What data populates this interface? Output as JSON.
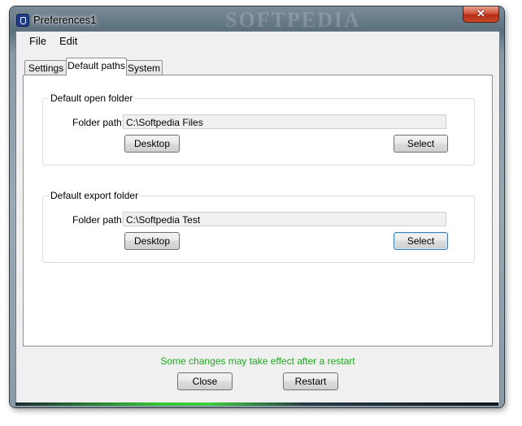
{
  "window": {
    "title": "Preferences1",
    "watermark": "SOFTPEDIA",
    "close_glyph": "✕"
  },
  "menu": [
    {
      "label": "File"
    },
    {
      "label": "Edit"
    }
  ],
  "tabs": [
    {
      "label": "Settings",
      "active": false
    },
    {
      "label": "Default paths",
      "active": true
    },
    {
      "label": "System",
      "active": false
    }
  ],
  "groups": {
    "open": {
      "title": "Default open folder",
      "field_label": "Folder path:",
      "value": "C:\\Softpedia Files",
      "desktop_label": "Desktop",
      "select_label": "Select"
    },
    "export": {
      "title": "Default export folder",
      "field_label": "Folder path:",
      "value": "C:\\Softpedia Test",
      "desktop_label": "Desktop",
      "select_label": "Select"
    }
  },
  "status_text": "Some changes may take effect after a restart",
  "status_color": "#1ca81c",
  "buttons": {
    "close": "Close",
    "restart": "Restart"
  }
}
